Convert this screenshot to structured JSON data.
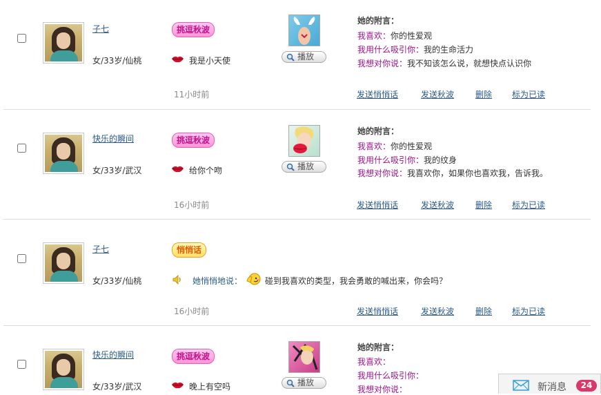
{
  "messages": [
    {
      "name": "子七",
      "info": "女/33岁/仙桃",
      "tag": "挑逗秋波",
      "kiss_text": "我是小天使",
      "play_label": "播放",
      "note_title": "她的附言：",
      "likes_label": "我喜欢：",
      "likes_value": "你的性爱观",
      "attract_label": "我用什么吸引你：",
      "attract_value": "我的生命活力",
      "say_label": "我想对你说：",
      "say_value": "我不知该怎么说，就想快点认识你",
      "time": "11小时前",
      "actions": [
        "发送悄悄话",
        "发送秋波",
        "删除",
        "标为已读"
      ]
    },
    {
      "name": "快乐的瞬间",
      "info": "女/33岁/武汉",
      "tag": "挑逗秋波",
      "kiss_text": "给你个吻",
      "play_label": "播放",
      "note_title": "她的附言：",
      "likes_label": "我喜欢：",
      "likes_value": "你的性爱观",
      "attract_label": "我用什么吸引你：",
      "attract_value": "我的纹身",
      "say_label": "我想对你说：",
      "say_value": "我喜欢你，如果你也喜欢我，告诉我。",
      "time": "16小时前",
      "actions": [
        "发送悄悄话",
        "发送秋波",
        "删除",
        "标为已读"
      ]
    },
    {
      "name": "子七",
      "info": "女/33岁/仙桃",
      "tag": "悄悄话",
      "whisper_label": "她悄悄地说：",
      "whisper_text": "碰到我喜欢的类型，我会勇敢的喊出来，你会吗？",
      "time": "16小时前",
      "actions": [
        "发送悄悄话",
        "发送秋波",
        "删除",
        "标为已读"
      ]
    },
    {
      "name": "快乐的瞬间",
      "info": "女/33岁/武汉",
      "tag": "挑逗秋波",
      "kiss_text": "晚上有空吗",
      "play_label": "播放",
      "note_title": "她的附言：",
      "likes_label": "我喜欢：",
      "likes_value": "",
      "attract_label": "我用什么吸引你：",
      "attract_value": "",
      "say_label": "我想对你说：",
      "say_value": ""
    }
  ],
  "notification": {
    "label": "新消息",
    "count": "24",
    "icon": "envelope-icon"
  },
  "colors": {
    "link": "#2a5a8c",
    "label_purple": "#a0148c",
    "tag_pink": "#ff93d9",
    "tag_yellow": "#ffe067",
    "badge": "#d9386a"
  }
}
